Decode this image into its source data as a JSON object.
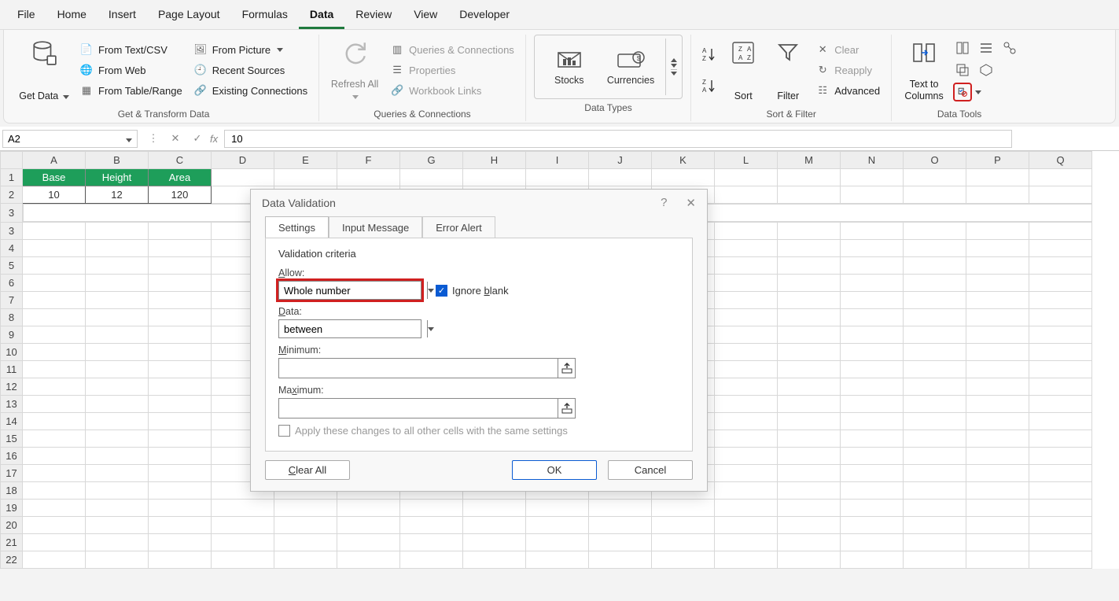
{
  "tabs": [
    "File",
    "Home",
    "Insert",
    "Page Layout",
    "Formulas",
    "Data",
    "Review",
    "View",
    "Developer"
  ],
  "active_tab_index": 5,
  "ribbon": {
    "get_transform": {
      "label": "Get & Transform Data",
      "getdata": "Get Data",
      "items": [
        "From Text/CSV",
        "From Web",
        "From Table/Range",
        "From Picture",
        "Recent Sources",
        "Existing Connections"
      ]
    },
    "qc": {
      "label": "Queries & Connections",
      "refresh": "Refresh All",
      "items": [
        "Queries & Connections",
        "Properties",
        "Workbook Links"
      ]
    },
    "datatypes": {
      "label": "Data Types",
      "items": [
        "Stocks",
        "Currencies"
      ]
    },
    "sortfilter": {
      "label": "Sort & Filter",
      "sort": "Sort",
      "filter": "Filter",
      "clear": "Clear",
      "reapply": "Reapply",
      "advanced": "Advanced"
    },
    "tools": {
      "label": "Data Tools",
      "ttc": "Text to Columns"
    }
  },
  "namebox": "A2",
  "formula_value": "10",
  "columns": [
    "A",
    "B",
    "C",
    "D",
    "E",
    "F",
    "G",
    "H",
    "I",
    "J",
    "K",
    "L",
    "M",
    "N",
    "O",
    "P",
    "Q"
  ],
  "rows": [
    "1",
    "2",
    "3",
    "4",
    "5",
    "6",
    "7",
    "8",
    "9",
    "10",
    "11",
    "12",
    "13",
    "14",
    "15",
    "16",
    "17",
    "18",
    "19",
    "20",
    "21",
    "22"
  ],
  "headers": [
    "Base",
    "Height",
    "Area"
  ],
  "datarow": [
    "10",
    "12",
    "120"
  ],
  "dialog": {
    "title": "Data Validation",
    "tabs": [
      "Settings",
      "Input Message",
      "Error Alert"
    ],
    "active_tab_index": 0,
    "criteria_label": "Validation criteria",
    "allow_label": "Allow:",
    "allow_value": "Whole number",
    "ignore_blank": "Ignore blank",
    "ignore_blank_checked": true,
    "data_label": "Data:",
    "data_value": "between",
    "min_label": "Minimum:",
    "min_value": "",
    "max_label": "Maximum:",
    "max_value": "",
    "apply_label": "Apply these changes to all other cells with the same settings",
    "apply_checked": false,
    "clear_all": "Clear All",
    "ok": "OK",
    "cancel": "Cancel"
  }
}
